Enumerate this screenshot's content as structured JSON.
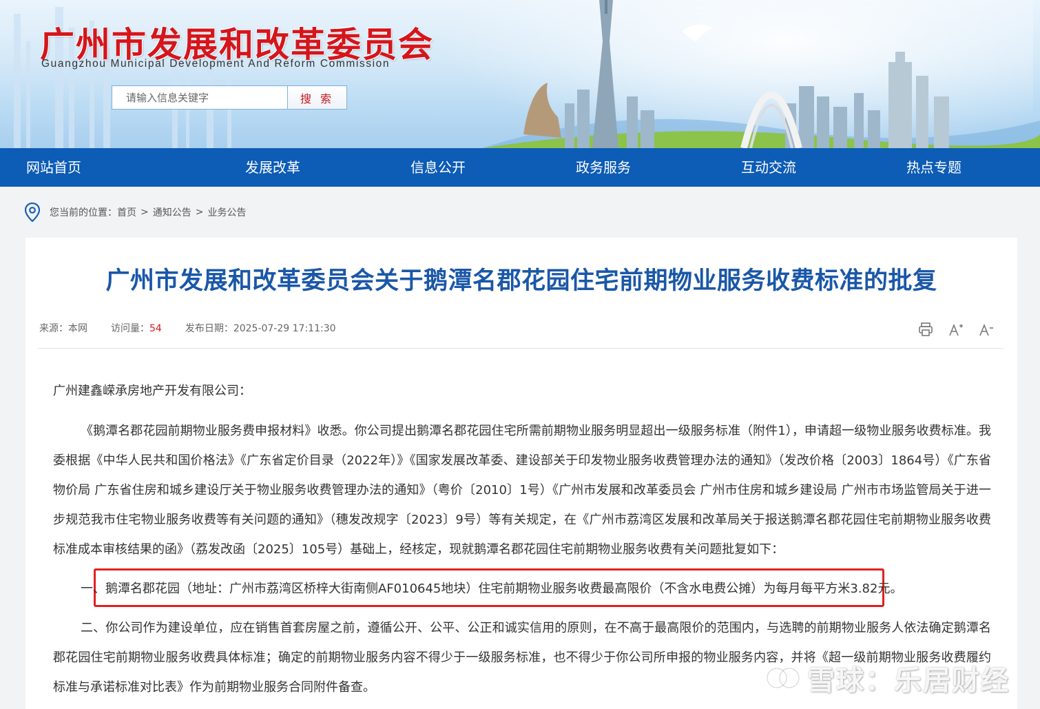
{
  "header": {
    "title": "广州市发展和改革委员会",
    "subtitle": "Guangzhou Municipal Development And Reform Commission",
    "search": {
      "placeholder": "请输入信息关键字",
      "button_label": "搜 索"
    }
  },
  "nav": {
    "items": [
      {
        "label": "网站首页"
      },
      {
        "label": "发展改革"
      },
      {
        "label": "信息公开"
      },
      {
        "label": "政务服务"
      },
      {
        "label": "互动交流"
      },
      {
        "label": "热点专题"
      }
    ]
  },
  "breadcrumb": {
    "prefix": "您当前的位置：",
    "items": [
      "首页",
      "通知公告",
      "业务公告"
    ],
    "separator": ">"
  },
  "article": {
    "title": "广州市发展和改革委员会关于鹅潭名郡花园住宅前期物业服务收费标准的批复",
    "meta": {
      "source_label": "来源：",
      "source": "本网",
      "visits_label": "访问量：",
      "visits": "54",
      "date_label": "发布日期：",
      "date": "2025-07-29 17:11:30"
    },
    "tools": [
      "print-icon",
      "font-larger-icon",
      "font-smaller-icon"
    ],
    "salutation": "广州建鑫嵘承房地产开发有限公司：",
    "paragraph1": "《鹅潭名郡花园前期物业服务费申报材料》收悉。你公司提出鹅潭名郡花园住宅所需前期物业服务明显超出一级服务标准（附件1），申请超一级物业服务收费标准。我委根据《中华人民共和国价格法》《广东省定价目录（2022年）》《国家发展改革委、建设部关于印发物业服务收费管理办法的通知》（发改价格〔2003〕1864号）《广东省物价局 广东省住房和城乡建设厅关于物业服务收费管理办法的通知》（粤价〔2010〕1号）《广州市发展和改革委员会 广州市住房和城乡建设局 广州市市场监管局关于进一步规范我市住宅物业服务收费等有关问题的通知》（穗发改规字〔2023〕9号）等有关规定，在《广州市荔湾区发展和改革局关于报送鹅潭名郡花园住宅前期物业服务收费标准成本审核结果的函》（荔发改函〔2025〕105号）基础上，经核定，现就鹅潭名郡花园住宅前期物业服务收费有关问题批复如下：",
    "paragraph2": "一、鹅潭名郡花园（地址：广州市荔湾区桥梓大街南侧AF010645地块）住宅前期物业服务收费最高限价（不含水电费公摊）为每月每平方米3.82元。",
    "paragraph3": "二、你公司作为建设单位，应在销售首套房屋之前，遵循公开、公平、公正和诚实信用的原则，在不高于最高限价的范围内，与选聘的前期物业服务人依法确定鹅潭名郡花园住宅前期物业服务收费具体标准；确定的前期物业服务内容不得少于一级服务标准，也不得少于你公司所申报的物业服务内容，并将《超一级前期物业服务收费履约标准与承诺标准对比表》作为前期物业服务合同附件备查。"
  },
  "watermark": {
    "text": "雪球：乐居财经"
  },
  "colors": {
    "nav_bg": "#0d5cb6",
    "title_red": "#d4161c",
    "article_title": "#1a57a8",
    "highlight_border": "#e0201f"
  }
}
